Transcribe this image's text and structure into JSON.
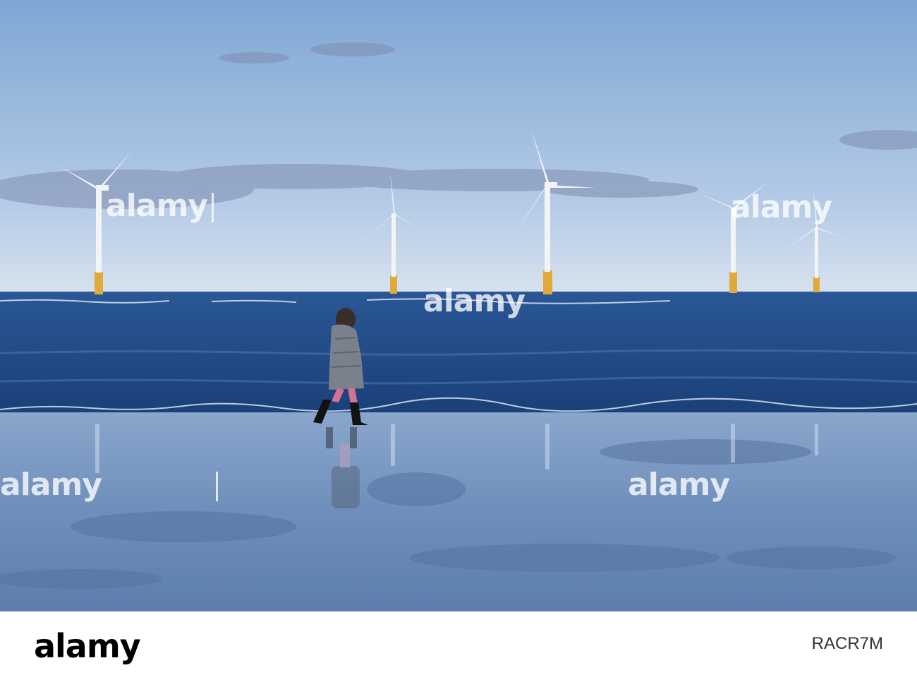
{
  "photo": {
    "subject": "woman-walking-on-wet-beach",
    "colors": {
      "sky_top": "#7ea7d4",
      "sky_bottom": "#c9daee",
      "sea": "#1f4a86",
      "sand": "#6f8fb9",
      "turbine": "#f2f4f6",
      "turbine_base": "#e0a93a"
    }
  },
  "watermark": {
    "text": "alamy",
    "repeat": 6
  },
  "footer": {
    "logo": "alamy",
    "image_id": "RACR7M"
  }
}
